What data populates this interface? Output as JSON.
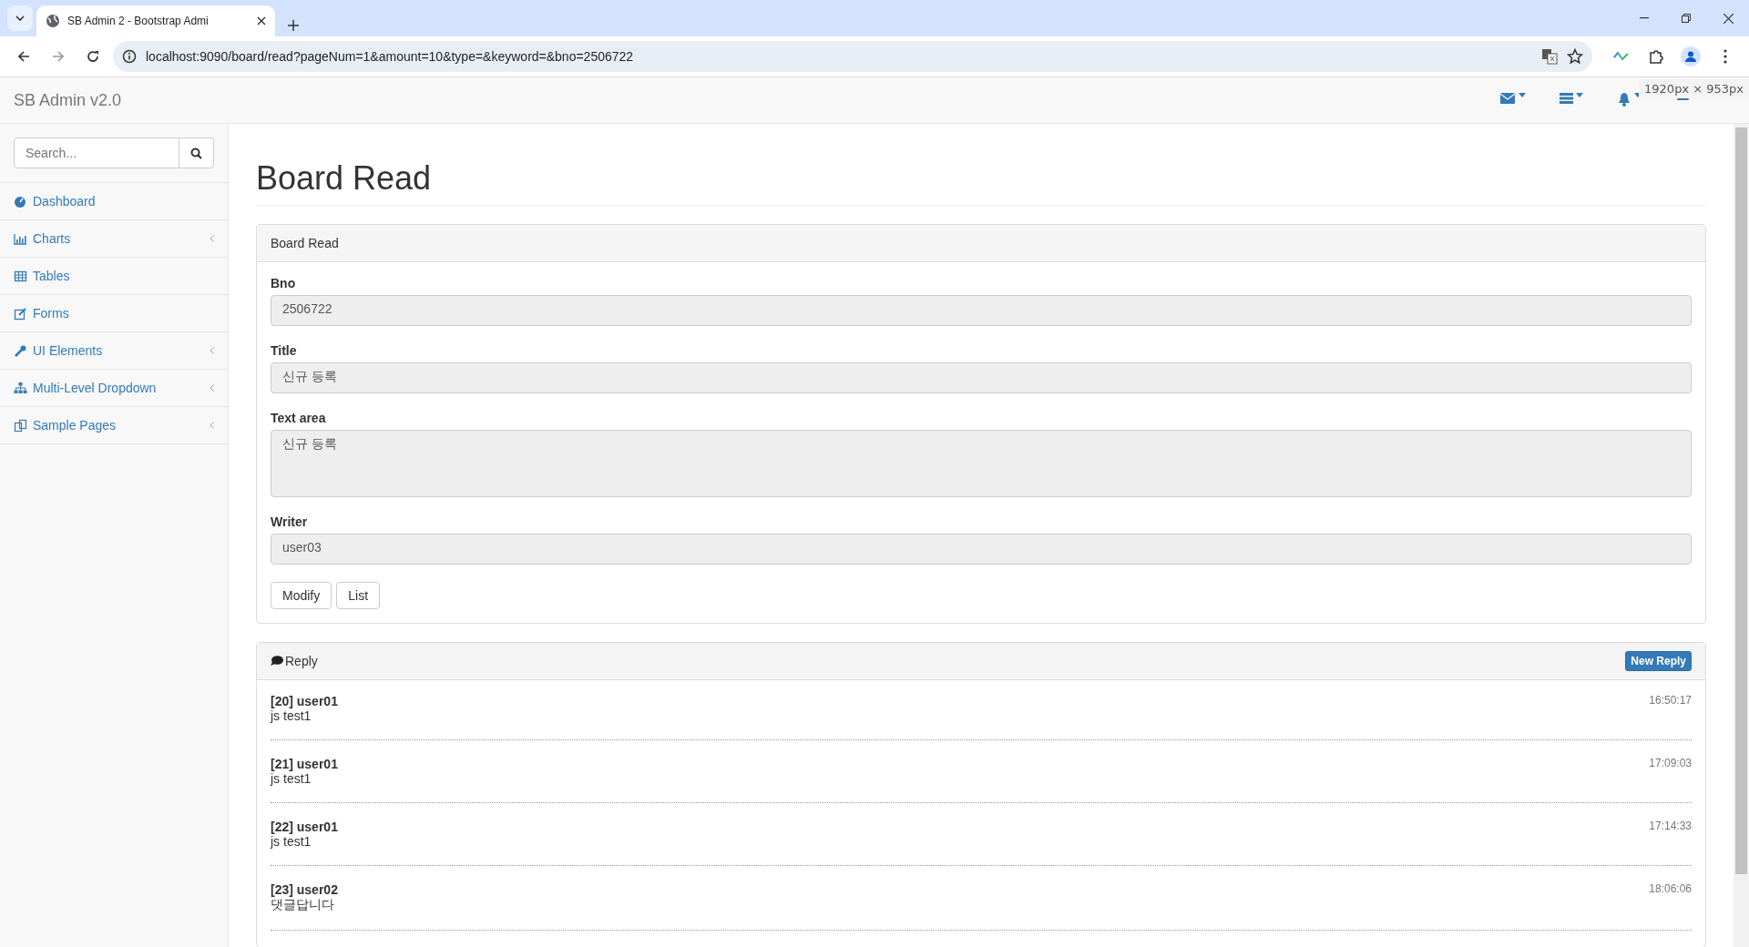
{
  "browser": {
    "tab_title": "SB Admin 2 - Bootstrap Admi",
    "url": "localhost:9090/board/read?pageNum=1&amount=10&type=&keyword=&bno=2506722",
    "size_tooltip": "1920px × 953px"
  },
  "navbar": {
    "brand": "SB Admin v2.0"
  },
  "sidebar": {
    "search": {
      "placeholder": "Search..."
    },
    "items": [
      {
        "label": "Dashboard",
        "has_submenu": false
      },
      {
        "label": "Charts",
        "has_submenu": true
      },
      {
        "label": "Tables",
        "has_submenu": false
      },
      {
        "label": "Forms",
        "has_submenu": false
      },
      {
        "label": "UI Elements",
        "has_submenu": true
      },
      {
        "label": "Multi-Level Dropdown",
        "has_submenu": true
      },
      {
        "label": "Sample Pages",
        "has_submenu": true
      }
    ]
  },
  "page": {
    "heading": "Board Read",
    "panel": {
      "title": "Board Read",
      "fields": [
        {
          "label": "Bno",
          "value": "2506722",
          "kind": "input"
        },
        {
          "label": "Title",
          "value": "신규 등록",
          "kind": "input"
        },
        {
          "label": "Text area",
          "value": "신규 등록",
          "kind": "textarea"
        },
        {
          "label": "Writer",
          "value": "user03",
          "kind": "input"
        }
      ],
      "buttons": [
        "Modify",
        "List"
      ]
    },
    "reply_panel": {
      "title": "Reply",
      "new_button": "New Reply",
      "replies": [
        {
          "header": "[20] user01",
          "text": "js test1",
          "time": "16:50:17"
        },
        {
          "header": "[21] user01",
          "text": "js test1",
          "time": "17:09:03"
        },
        {
          "header": "[22] user01",
          "text": "js test1",
          "time": "17:14:33"
        },
        {
          "header": "[23] user02",
          "text": "댓글답니다",
          "time": "18:06:06"
        }
      ]
    }
  }
}
